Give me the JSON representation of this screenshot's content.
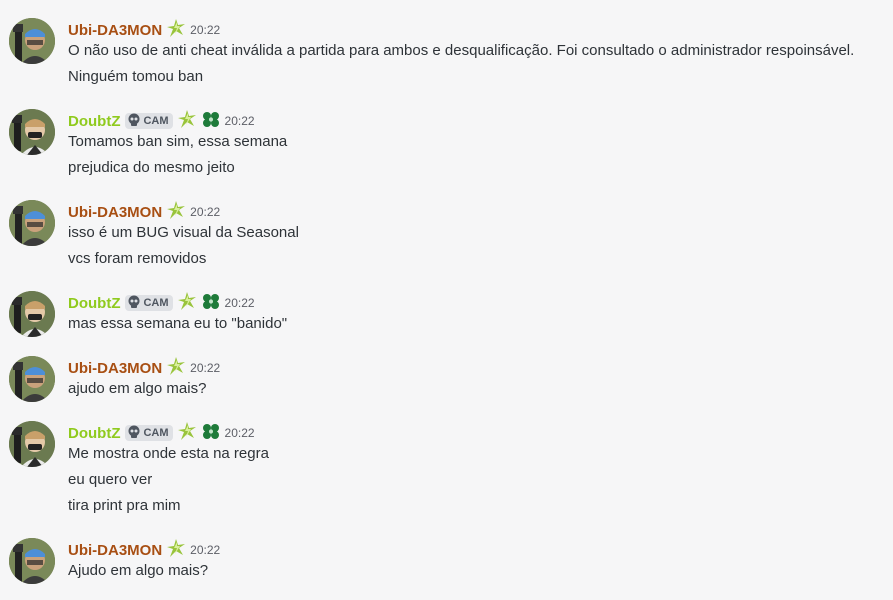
{
  "colors": {
    "ubi_name": "#a84f13",
    "doubt_name": "#8fca1e",
    "lightning_badge": "#99c43b",
    "clover_badge": "#1e7b3a",
    "timestamp": "#5c5e66",
    "text": "#2e3338",
    "background": "#f6f6f7"
  },
  "icons": {
    "role_badge": "lightning-badge-icon",
    "clover_badge": "clover-badge-icon",
    "skull_tag": "skull-icon"
  },
  "users": {
    "ubi": {
      "name": "Ubi-DA3MON"
    },
    "doubt": {
      "name": "DoubtZ",
      "tag": "CAM"
    }
  },
  "messages": [
    {
      "author": "ubi",
      "time": "20:22",
      "lines": [
        "O não uso de anti cheat inválida a partida para ambos e desqualificação. Foi consultado o administrador respoinsável.",
        "Ninguém tomou ban"
      ]
    },
    {
      "author": "doubt",
      "time": "20:22",
      "lines": [
        "Tomamos ban sim, essa semana",
        "prejudica do mesmo jeito"
      ]
    },
    {
      "author": "ubi",
      "time": "20:22",
      "lines": [
        "isso é um BUG visual da Seasonal",
        "vcs foram removidos"
      ]
    },
    {
      "author": "doubt",
      "time": "20:22",
      "lines": [
        "mas essa semana eu to \"banido\""
      ]
    },
    {
      "author": "ubi",
      "time": "20:22",
      "lines": [
        "ajudo em algo mais?"
      ]
    },
    {
      "author": "doubt",
      "time": "20:22",
      "lines": [
        "Me mostra onde esta na regra",
        "eu quero ver",
        "tira print pra mim"
      ]
    },
    {
      "author": "ubi",
      "time": "20:22",
      "lines": [
        "Ajudo em algo mais?"
      ]
    }
  ]
}
